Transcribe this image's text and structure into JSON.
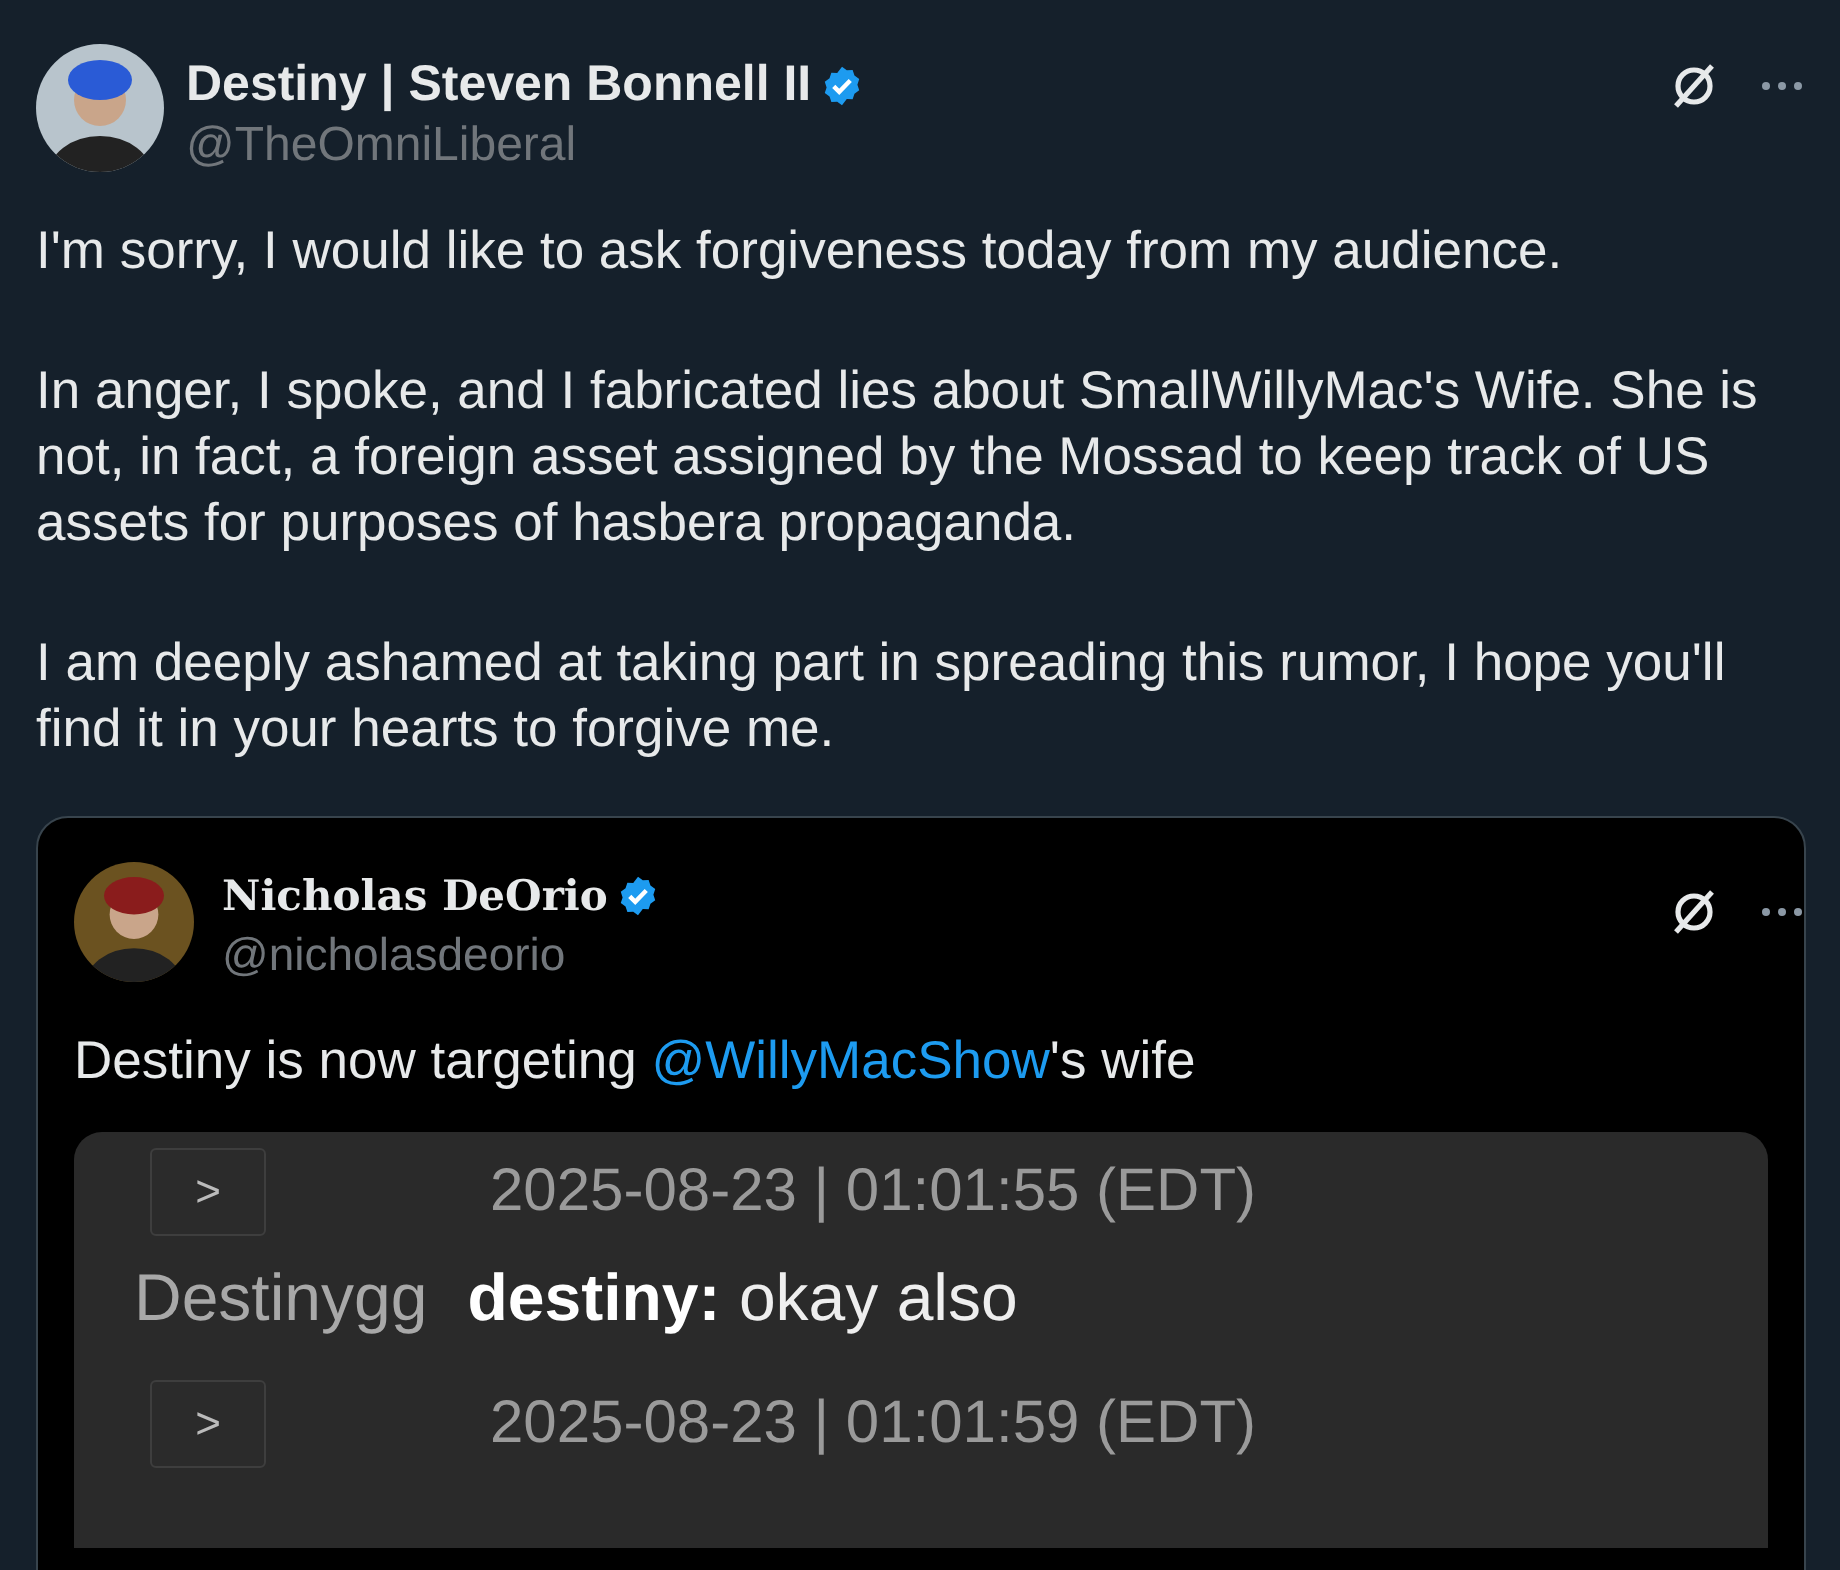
{
  "author": {
    "name": "Destiny | Steven Bonnell II",
    "handle": "@TheOmniLiberal",
    "verified": true
  },
  "paragraphs": [
    "I'm sorry, I would like to ask forgiveness today from my audience.",
    "In anger, I spoke, and I fabricated lies about SmallWillyMac's Wife. She is not, in fact, a foreign asset assigned by the Mossad to keep track of US assets for purposes of hasbera propaganda.",
    "I am deeply ashamed at taking part in spreading this rumor, I hope you'll find it in your hearts to forgive me."
  ],
  "quote": {
    "author": {
      "name": "Nicholas DeOrio",
      "handle": "@nicholasdeorio",
      "verified": true
    },
    "text_before": "Destiny is now targeting ",
    "mention": "@WillyMacShow",
    "text_after": "'s wife",
    "chat": [
      {
        "button_label": ">",
        "timestamp": "2025-08-23 | 01:01:55 (EDT)",
        "source": "Destinygg",
        "message": "**destiny:** okay also"
      },
      {
        "button_label": ">",
        "timestamp": "2025-08-23 | 01:01:59 (EDT)"
      }
    ]
  }
}
